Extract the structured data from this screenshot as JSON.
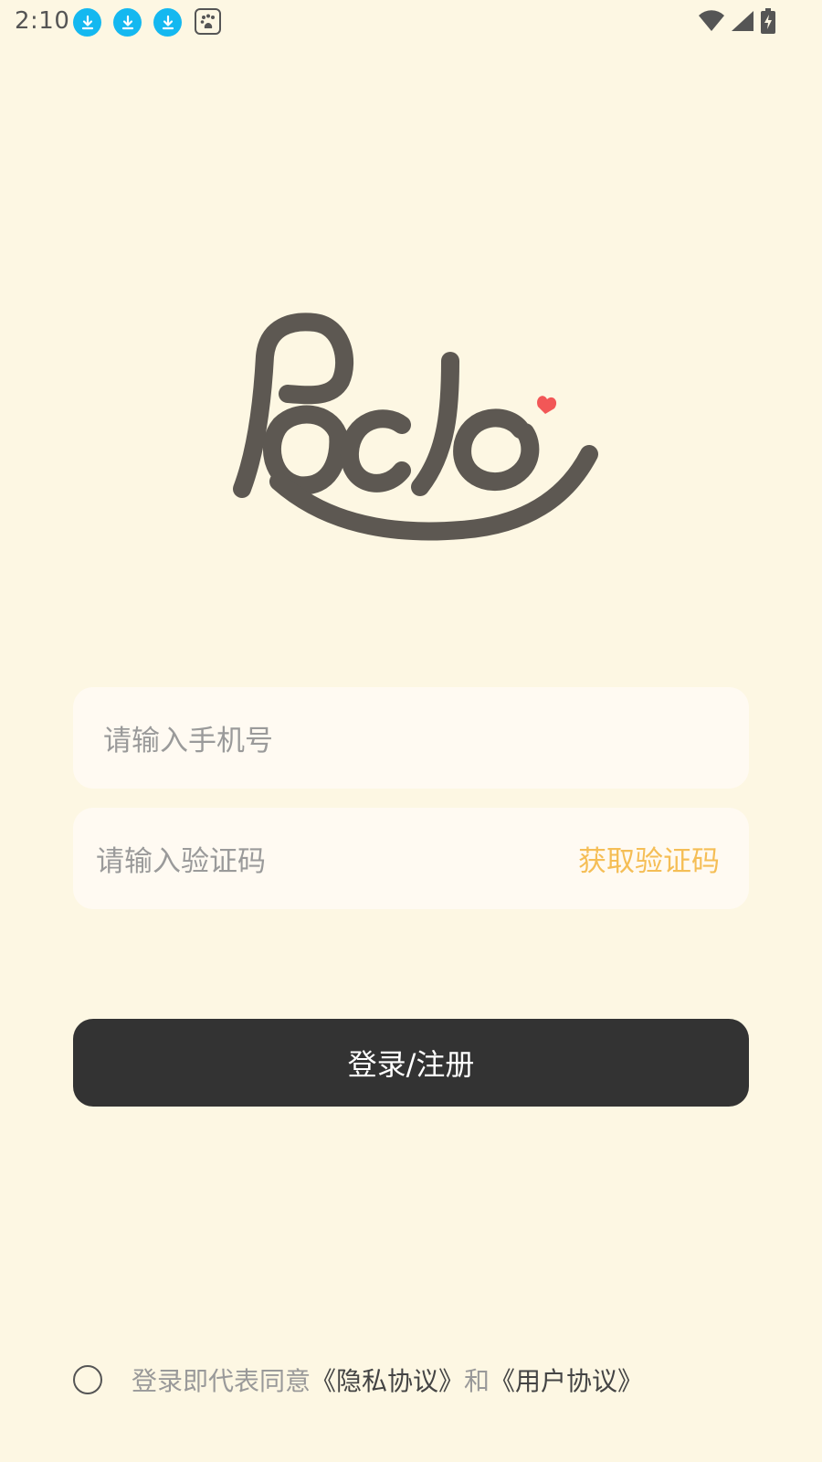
{
  "status_bar": {
    "time": "2:10",
    "left_icons": [
      "download-icon",
      "download-icon",
      "download-icon",
      "baidu-icon"
    ],
    "right_icons": [
      "wifi-icon",
      "signal-icon",
      "battery-charging-icon"
    ]
  },
  "logo": {
    "icon": "pado-logo",
    "text_color": "#5D5852",
    "heart_color": "#F25757"
  },
  "form": {
    "phone_placeholder": "请输入手机号",
    "code_placeholder": "请输入验证码",
    "get_code_label": "获取验证码",
    "get_code_color": "#F5BE56"
  },
  "login_button": {
    "label": "登录/注册",
    "color": "#333333"
  },
  "agreement": {
    "prefix": "登录即代表同意",
    "privacy_link": "《隐私协议》",
    "conjunction": "和",
    "user_link": "《用户协议》"
  },
  "colors": {
    "background": "#FDF7E3",
    "input_background": "#FFFAF2",
    "download_icon": "#14B8F0"
  }
}
